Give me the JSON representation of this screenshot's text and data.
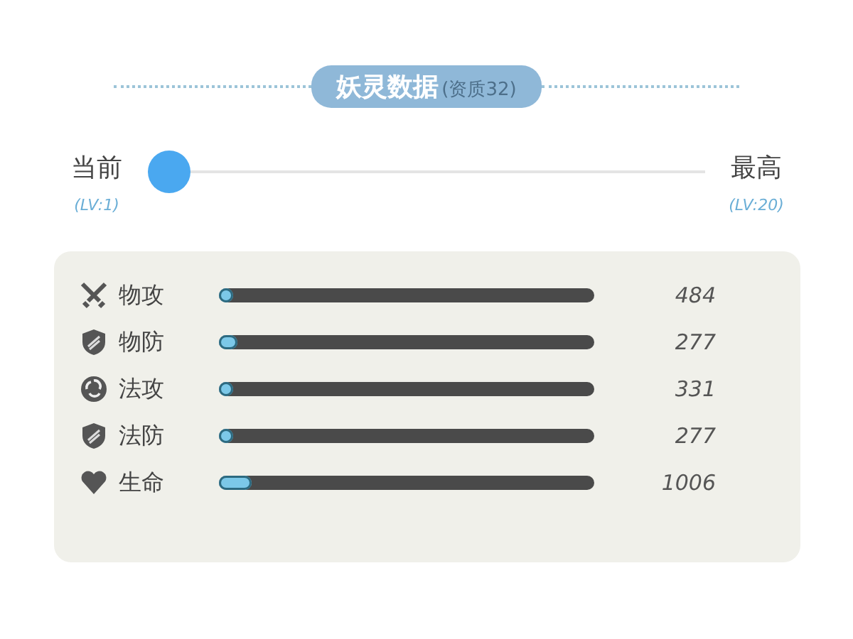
{
  "header": {
    "title": "妖灵数据",
    "subtitle": "(资质32)"
  },
  "level_slider": {
    "start_label": "当前",
    "start_level": "(LV:1)",
    "end_label": "最高",
    "end_level": "(LV:20)",
    "level": 0
  },
  "stats": [
    {
      "kind": "sword",
      "label": "物攻",
      "level": 0.03,
      "value": "484"
    },
    {
      "kind": "shield",
      "label": "物防",
      "level": 0.05,
      "value": "277"
    },
    {
      "kind": "swirl",
      "label": "法攻",
      "level": 0.02,
      "value": "331"
    },
    {
      "kind": "shield",
      "label": "法防",
      "level": 0.04,
      "value": "277"
    },
    {
      "kind": "heart",
      "label": "生命",
      "level": 0.09,
      "value": "1006"
    }
  ]
}
